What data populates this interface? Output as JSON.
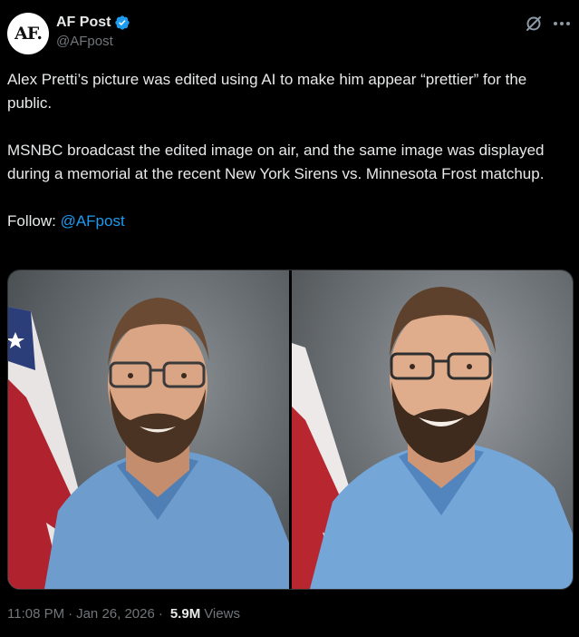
{
  "account": {
    "avatar_text": "AF.",
    "display_name": "AF Post",
    "handle": "@AFpost",
    "verified": true
  },
  "icons": {
    "verified": "verified-badge-icon",
    "grok": "grok-icon",
    "more": "more-options-icon"
  },
  "tweet": {
    "paragraph_1": "Alex Pretti’s picture was edited using AI to make him appear “prettier” for the public.",
    "paragraph_2": "MSNBC broadcast the edited image on air, and the same image was displayed during a memorial at the recent New York Sirens vs. Minnesota Frost matchup.",
    "follow_label": "Follow: ",
    "follow_mention": "@AFpost"
  },
  "media": {
    "count": 2
  },
  "footer": {
    "time": "11:08 PM",
    "separator": "·",
    "date": "Jan 26, 2026",
    "views_count": "5.9M",
    "views_label": "Views"
  },
  "colors": {
    "background": "#000000",
    "text": "#e7e9ea",
    "secondary": "#71767b",
    "link": "#1d9bf0",
    "verified": "#1d9bf0"
  }
}
